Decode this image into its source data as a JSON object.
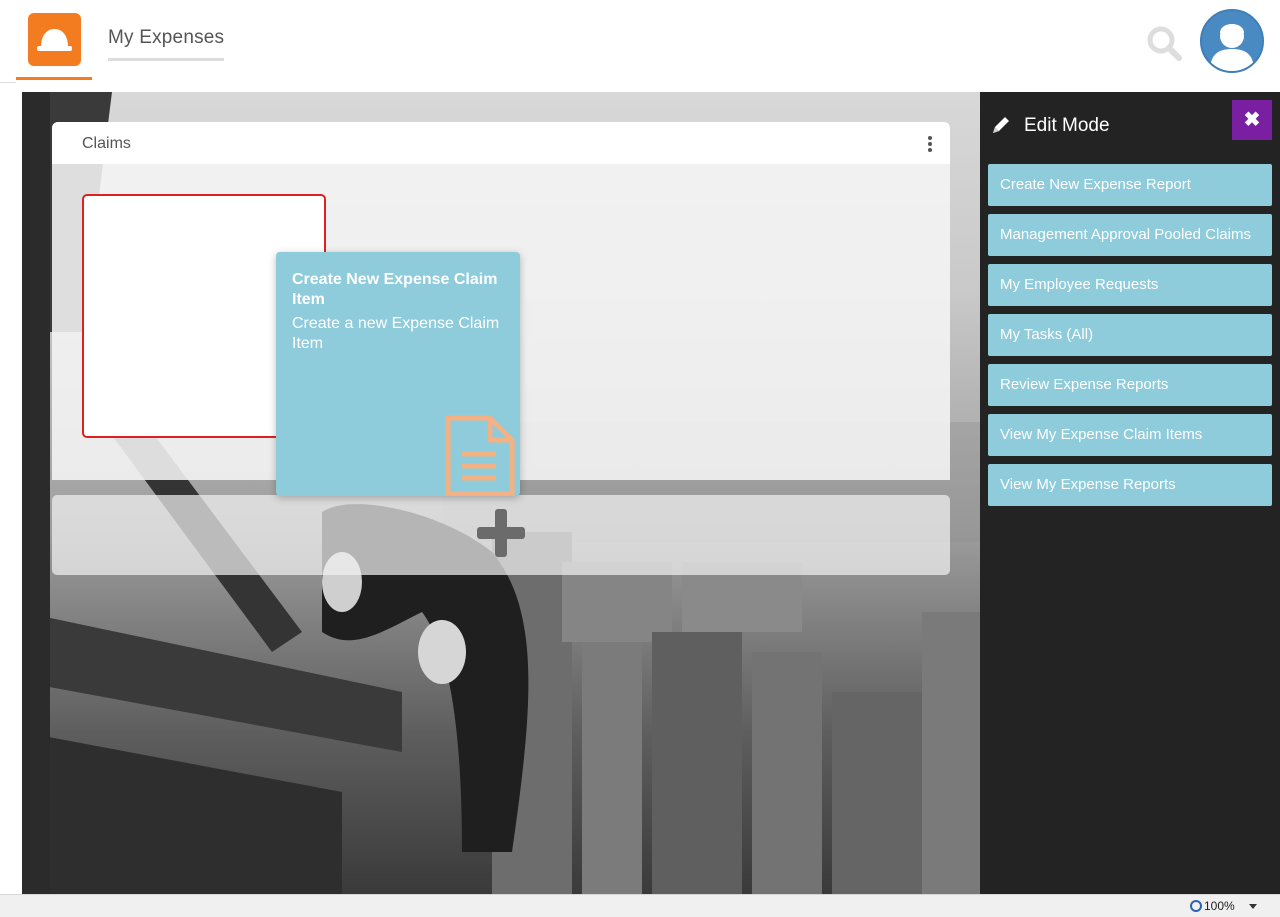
{
  "header": {
    "logo_icon": "hard-hat-icon",
    "nav_tab_label": "My Expenses",
    "search_icon": "search-icon",
    "avatar_icon": "user-avatar-icon",
    "accent_color": "#f47c20"
  },
  "claims_panel": {
    "title": "Claims",
    "menu_icon": "kebab-menu-icon",
    "add_icon": "plus-icon"
  },
  "dragged_tile": {
    "title": "Create New Expense Claim Item",
    "description": "Create a new Expense Claim Item",
    "icon": "document-icon",
    "color": "#8ecbdb"
  },
  "sidebar": {
    "title": "Edit Mode",
    "edit_icon": "pencil-icon",
    "close_icon": "close-icon",
    "close_label": "✖",
    "close_color": "#7b1fa2",
    "items": [
      {
        "label": "Create New Expense Report"
      },
      {
        "label": "Management Approval Pooled Claims"
      },
      {
        "label": "My Employee Requests"
      },
      {
        "label": "My Tasks (All)"
      },
      {
        "label": "Review Expense Reports"
      },
      {
        "label": "View My Expense Claim Items"
      },
      {
        "label": "View My Expense Reports"
      }
    ]
  },
  "statusbar": {
    "zoom": "100%"
  }
}
